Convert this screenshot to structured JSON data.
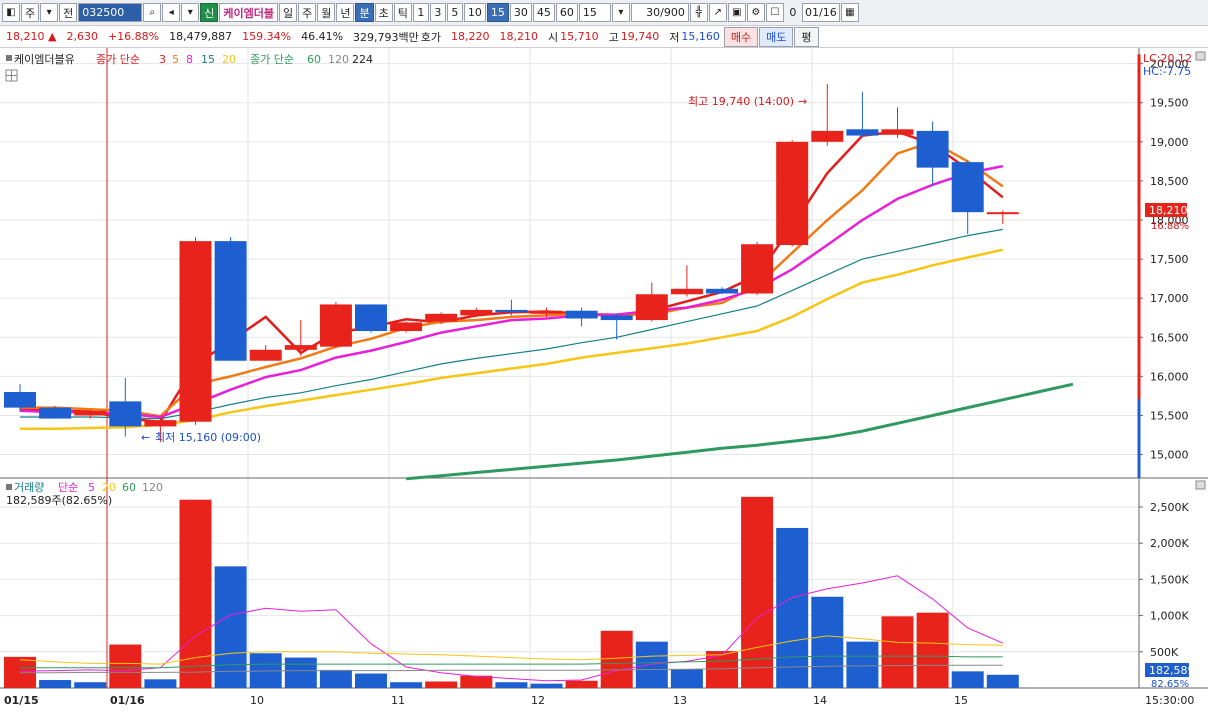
{
  "toolbar": {
    "market": "주",
    "prev_label": "전",
    "code": "032500",
    "credit_label": "신",
    "stock_name": "케이엠더블",
    "periods": [
      "일",
      "주",
      "월",
      "년",
      "분",
      "초",
      "틱"
    ],
    "active_period": "분",
    "intervals": [
      "1",
      "3",
      "5",
      "10",
      "15",
      "30",
      "45",
      "60"
    ],
    "active_interval": "15",
    "interval_select": "15",
    "count": "30/900",
    "checkbox_label": "0",
    "date": "01/16"
  },
  "quote": {
    "price": "18,210",
    "change": "2,630",
    "change_pct": "+16.88%",
    "volume": "18,479,887",
    "vol_ratio": "159.34%",
    "turnover": "46.41%",
    "amount": "329,793백만",
    "ask_label": "호가",
    "ask": "18,220",
    "bid": "18,210",
    "open_label": "시",
    "open": "15,710",
    "high_label": "고",
    "high": "19,740",
    "low_label": "저",
    "low": "15,160",
    "buy_label": "매수",
    "sell_label": "매도",
    "avg_label": "평"
  },
  "colors": {
    "up": "#e8231b",
    "down": "#1d5fd0",
    "ma3": "#e41b1b",
    "ma5": "#f07a16",
    "ma8": "#e81fd8",
    "ma15": "#17808a",
    "ma20": "#f7c614",
    "ma60": "#2f9a5f",
    "ma120": "#888888",
    "ma224": "#222222"
  },
  "price_panel": {
    "legend_name": "케이엠더블유",
    "legend_type": "종가 단순",
    "legend_ma_short": [
      "3",
      "5",
      "8",
      "15",
      "20"
    ],
    "legend_type2": "종가 단순",
    "legend_ma_long": [
      "60",
      "120",
      "224"
    ],
    "lc": "LC:20.12",
    "hc": "HC:-7.75",
    "high_annotation": "최고 19,740 (14:00)",
    "low_annotation": "최저 15,160 (09:00)",
    "current_price": "18,210",
    "current_pct": "16.88%"
  },
  "volume_panel": {
    "legend_name": "거래량",
    "legend_type": "단순",
    "legend_ma": [
      "5",
      "20",
      "60",
      "120"
    ],
    "legend_value": "182,589주(82.65%)",
    "current_volume": "182,589",
    "current_pct": "82.65%"
  },
  "x_axis": {
    "labels": [
      "01/15",
      "01/16",
      "10",
      "11",
      "12",
      "13",
      "14",
      "15"
    ],
    "time_label": "15:30:00"
  },
  "chart_data": [
    {
      "type": "candlestick",
      "title": "케이엠더블유",
      "ylim": [
        14700,
        20200
      ],
      "y_ticks": [
        15000,
        15500,
        16000,
        16500,
        17000,
        17500,
        18000,
        18500,
        19000,
        19500,
        20000
      ],
      "candles": [
        {
          "o": 15800,
          "h": 15900,
          "l": 15550,
          "c": 15600
        },
        {
          "o": 15600,
          "h": 15620,
          "l": 15460,
          "c": 15460
        },
        {
          "o": 15500,
          "h": 15560,
          "l": 15460,
          "c": 15560
        },
        {
          "o": 15680,
          "h": 15980,
          "l": 15230,
          "c": 15360
        },
        {
          "o": 15360,
          "h": 15470,
          "l": 15160,
          "c": 15440
        },
        {
          "o": 15420,
          "h": 17780,
          "l": 15380,
          "c": 17730
        },
        {
          "o": 17730,
          "h": 17780,
          "l": 16200,
          "c": 16200
        },
        {
          "o": 16200,
          "h": 16400,
          "l": 16200,
          "c": 16340
        },
        {
          "o": 16340,
          "h": 16720,
          "l": 16260,
          "c": 16400
        },
        {
          "o": 16380,
          "h": 16950,
          "l": 16360,
          "c": 16920
        },
        {
          "o": 16920,
          "h": 16920,
          "l": 16560,
          "c": 16580
        },
        {
          "o": 16580,
          "h": 16700,
          "l": 16560,
          "c": 16690
        },
        {
          "o": 16700,
          "h": 16820,
          "l": 16680,
          "c": 16800
        },
        {
          "o": 16780,
          "h": 16880,
          "l": 16760,
          "c": 16850
        },
        {
          "o": 16850,
          "h": 16980,
          "l": 16780,
          "c": 16820
        },
        {
          "o": 16800,
          "h": 16880,
          "l": 16760,
          "c": 16840
        },
        {
          "o": 16840,
          "h": 16880,
          "l": 16640,
          "c": 16740
        },
        {
          "o": 16780,
          "h": 16800,
          "l": 16470,
          "c": 16720
        },
        {
          "o": 16720,
          "h": 17200,
          "l": 16700,
          "c": 17050
        },
        {
          "o": 17050,
          "h": 17420,
          "l": 17020,
          "c": 17120
        },
        {
          "o": 17120,
          "h": 17140,
          "l": 17050,
          "c": 17060
        },
        {
          "o": 17060,
          "h": 17720,
          "l": 17040,
          "c": 17690
        },
        {
          "o": 17680,
          "h": 19020,
          "l": 17660,
          "c": 19000
        },
        {
          "o": 19000,
          "h": 19740,
          "l": 18950,
          "c": 19140
        },
        {
          "o": 19160,
          "h": 19640,
          "l": 19060,
          "c": 19080
        },
        {
          "o": 19090,
          "h": 19440,
          "l": 19050,
          "c": 19160
        },
        {
          "o": 19140,
          "h": 19260,
          "l": 18440,
          "c": 18670
        },
        {
          "o": 18740,
          "h": 18760,
          "l": 17820,
          "c": 18100
        },
        {
          "o": 18100,
          "h": 18120,
          "l": 17950,
          "c": 18100
        }
      ],
      "series": [
        {
          "name": "3",
          "color_key": "ma3",
          "values": [
            15580,
            15560,
            15550,
            15460,
            15420,
            16150,
            16450,
            16760,
            16300,
            16560,
            16630,
            16730,
            16690,
            16780,
            16820,
            16830,
            16800,
            16780,
            16840,
            16960,
            17080,
            17290,
            17920,
            18600,
            19080,
            19130,
            18970,
            18650,
            18290
          ]
        },
        {
          "name": "5",
          "color_key": "ma5",
          "values": [
            15600,
            15600,
            15580,
            15560,
            15490,
            15900,
            16000,
            16120,
            16230,
            16380,
            16480,
            16620,
            16700,
            16720,
            16760,
            16780,
            16800,
            16790,
            16790,
            16880,
            16940,
            17160,
            17580,
            18000,
            18380,
            18850,
            19000,
            18750,
            18430
          ]
        },
        {
          "name": "8",
          "color_key": "ma8",
          "values": [
            15560,
            15540,
            15540,
            15520,
            15480,
            15650,
            15830,
            15990,
            16080,
            16240,
            16330,
            16440,
            16560,
            16640,
            16720,
            16740,
            16780,
            16790,
            16840,
            16880,
            16980,
            17120,
            17370,
            17680,
            18000,
            18270,
            18450,
            18600,
            18690
          ]
        },
        {
          "name": "15",
          "color_key": "ma15",
          "values": [
            15480,
            15480,
            15480,
            15470,
            15460,
            15540,
            15640,
            15730,
            15790,
            15880,
            15960,
            16060,
            16160,
            16230,
            16290,
            16350,
            16430,
            16500,
            16600,
            16700,
            16800,
            16900,
            17100,
            17300,
            17500,
            17600,
            17700,
            17800,
            17880
          ]
        },
        {
          "name": "20",
          "color_key": "ma20",
          "values": [
            15330,
            15330,
            15340,
            15350,
            15380,
            15440,
            15540,
            15620,
            15690,
            15760,
            15830,
            15900,
            15980,
            16040,
            16100,
            16160,
            16240,
            16300,
            16360,
            16420,
            16500,
            16580,
            16760,
            16990,
            17200,
            17300,
            17420,
            17520,
            17620
          ]
        },
        {
          "name": "60",
          "color_key": "ma60",
          "x_start": 11,
          "values": [
            14690,
            14730,
            14770,
            14810,
            14850,
            14890,
            14930,
            14980,
            15030,
            15080,
            15120,
            15170,
            15220,
            15300,
            15400,
            15500,
            15600,
            15700,
            15800,
            15900
          ]
        }
      ]
    },
    {
      "type": "bar",
      "title": "거래량",
      "ylim": [
        0,
        2900000
      ],
      "y_ticks": [
        500000,
        1000000,
        1500000,
        2000000,
        2500000
      ],
      "values": [
        430000,
        110000,
        80000,
        600000,
        120000,
        2600000,
        1680000,
        480000,
        420000,
        250000,
        200000,
        80000,
        90000,
        170000,
        80000,
        60000,
        100000,
        790000,
        640000,
        260000,
        510000,
        2640000,
        2210000,
        1260000,
        640000,
        990000,
        1040000,
        230000,
        182589
      ],
      "up": [
        true,
        false,
        false,
        true,
        false,
        true,
        false,
        false,
        false,
        false,
        false,
        false,
        true,
        true,
        false,
        false,
        true,
        true,
        false,
        false,
        true,
        true,
        false,
        false,
        false,
        true,
        true,
        false,
        false
      ],
      "series": [
        {
          "name": "5",
          "color_key": "ma8",
          "values": [
            230000,
            240000,
            250000,
            240000,
            280000,
            720000,
            1010000,
            1100000,
            1060000,
            1080000,
            610000,
            290000,
            210000,
            160000,
            130000,
            100000,
            110000,
            240000,
            330000,
            370000,
            450000,
            970000,
            1250000,
            1370000,
            1450000,
            1550000,
            1230000,
            830000,
            620000
          ]
        },
        {
          "name": "20",
          "color_key": "ma20",
          "values": [
            390000,
            360000,
            340000,
            340000,
            330000,
            420000,
            480000,
            500000,
            500000,
            500000,
            480000,
            470000,
            460000,
            440000,
            420000,
            400000,
            390000,
            410000,
            440000,
            450000,
            460000,
            560000,
            650000,
            720000,
            680000,
            630000,
            620000,
            600000,
            590000
          ]
        },
        {
          "name": "60",
          "color_key": "ma60",
          "values": [
            280000,
            280000,
            280000,
            280000,
            280000,
            300000,
            320000,
            330000,
            330000,
            330000,
            330000,
            330000,
            330000,
            330000,
            330000,
            330000,
            330000,
            340000,
            350000,
            360000,
            370000,
            400000,
            430000,
            440000,
            440000,
            440000,
            440000,
            430000,
            430000
          ]
        },
        {
          "name": "120",
          "color_key": "ma120",
          "values": [
            210000,
            210000,
            215000,
            215000,
            215000,
            220000,
            230000,
            235000,
            240000,
            240000,
            240000,
            240000,
            245000,
            245000,
            245000,
            245000,
            245000,
            250000,
            255000,
            260000,
            265000,
            280000,
            290000,
            300000,
            305000,
            310000,
            315000,
            315000,
            315000
          ]
        }
      ]
    }
  ]
}
